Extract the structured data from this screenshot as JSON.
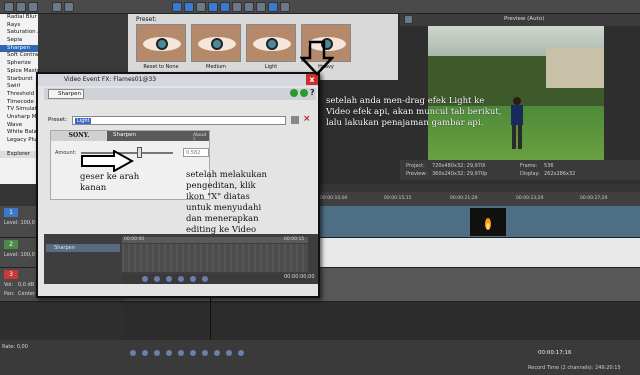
{
  "effects_list": {
    "items": [
      "Radial Blur",
      "Rays",
      "Saturation Adjust",
      "Sepia",
      "Sharpen",
      "Soft Contrast",
      "Spherize",
      "Spice Master",
      "Starburst",
      "Swirl",
      "Threshold",
      "Timecode",
      "TV Simulator",
      "Unsharp Mask",
      "Wave",
      "White Balance",
      "Legacy Plugins"
    ],
    "selected_index": 4,
    "tab_label": "Explorer"
  },
  "preset_panel": {
    "label": "Preset:",
    "thumbnails": [
      "Reset to None",
      "Medium",
      "Light",
      "Heavy"
    ]
  },
  "preview": {
    "dropdown": "Preview (Auto)",
    "info": {
      "project": "Project:",
      "project_val": "720x480x32; 29,970i",
      "preview": "Preview:",
      "preview_val": "360x240x32; 29,970p",
      "frame": "Frame:",
      "frame_val": "536",
      "display": "Display:",
      "display_val": "262x286x32"
    }
  },
  "timeline": {
    "ruler_labels": [
      "00:00:00",
      "00:00:05;15",
      "00:00:10;00",
      "00:00:15;15",
      "00:00:21;29",
      "00:00:23;29",
      "00:00:27;29"
    ],
    "tracks": [
      {
        "num": "1",
        "level_label": "Level: 100,0 %",
        "color": "#3a78c8"
      },
      {
        "num": "2",
        "level_label": "Level: 100,0 %",
        "color": "#4a8a4a"
      },
      {
        "num": "3",
        "vol_label": "Vol:",
        "vol_val": "0,0 dB",
        "pan_label": "Pan:",
        "pan_val": "Center",
        "color": "#c83a3a"
      }
    ],
    "rate_label": "Rate: 0,00",
    "time_display": "00:00:17;16",
    "record_time": "Record Time (2 channels): 249:20:15"
  },
  "dialog": {
    "title": "Video Event FX: Flames01@33",
    "close_label": "x",
    "chain_chip": "Sharpen",
    "preset_label": "Preset:",
    "preset_value": "Light",
    "plugin_brand": "SONY.",
    "plugin_name": "Sharpen",
    "about_label": "About ?",
    "amount_label": "Amount:",
    "amount_value": "0.582",
    "amount_fraction": 0.62,
    "track_label": "Sharpen",
    "time_start": "00:00:00",
    "time_end": "00:00:15",
    "time_display": "00:00:00;00"
  },
  "annotations": {
    "right_note": "setelah anda men-drag efek Light ke\nVideo efek api, akan muncul tab berikut,\nlalu lakukan penajaman gambar api.",
    "left_note": "geser ke arah\nkanan",
    "middle_note": "setelah melakukan\npengeditan, klik\nikon \"X\" diatas\nuntuk menyudahi\ndan menerapkan\nediting ke Video"
  }
}
